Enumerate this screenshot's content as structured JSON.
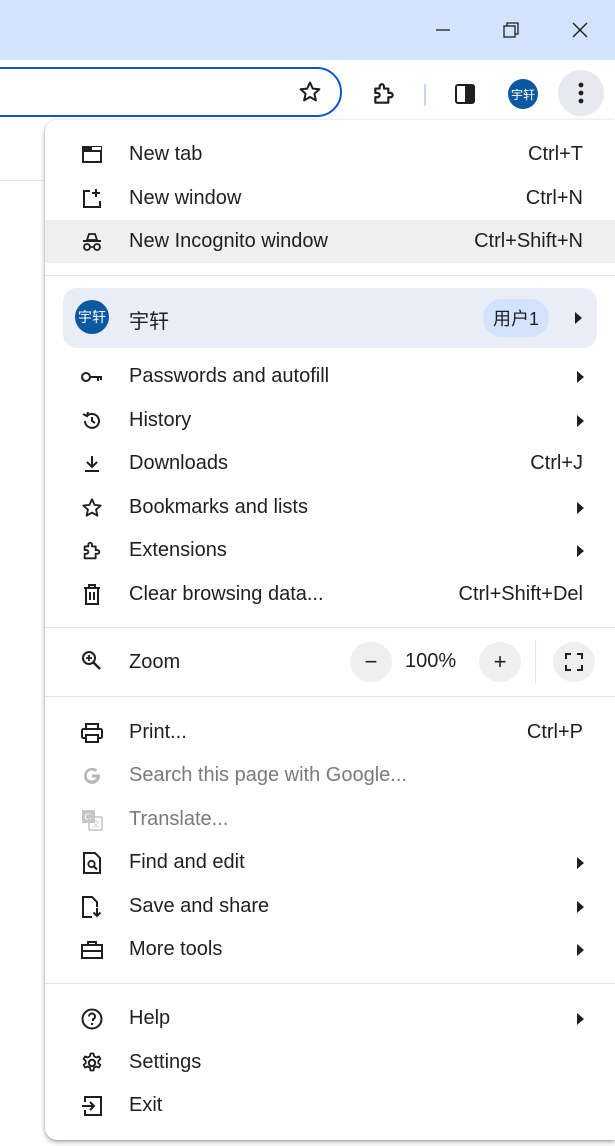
{
  "window": {
    "controls": [
      "minimize-icon",
      "restore-icon",
      "close-icon"
    ],
    "colors": {
      "titlebar": "#d3e3fd",
      "accent": "#0b57d0",
      "avatar": "#0b57a0"
    }
  },
  "toolbar": {
    "avatar_text": "宇轩"
  },
  "menu": {
    "group1": [
      {
        "icon": "new-tab-icon",
        "label": "New tab",
        "shortcut": "Ctrl+T"
      },
      {
        "icon": "new-window-icon",
        "label": "New window",
        "shortcut": "Ctrl+N"
      },
      {
        "icon": "incognito-icon",
        "label": "New Incognito window",
        "shortcut": "Ctrl+Shift+N"
      }
    ],
    "profile": {
      "avatar_text": "宇轩",
      "name": "宇轩",
      "badge": "用户1"
    },
    "group2": [
      {
        "icon": "key-icon",
        "label": "Passwords and autofill"
      },
      {
        "icon": "history-icon",
        "label": "History"
      },
      {
        "icon": "download-icon",
        "label": "Downloads",
        "shortcut": "Ctrl+J"
      },
      {
        "icon": "star-icon",
        "label": "Bookmarks and lists"
      },
      {
        "icon": "extensions-icon",
        "label": "Extensions"
      },
      {
        "icon": "trash-icon",
        "label": "Clear browsing data...",
        "shortcut": "Ctrl+Shift+Del"
      }
    ],
    "zoom": {
      "label": "Zoom",
      "value": "100%",
      "minus": "−",
      "plus": "+"
    },
    "group3": [
      {
        "icon": "print-icon",
        "label": "Print...",
        "shortcut": "Ctrl+P"
      },
      {
        "icon": "google-icon",
        "label": "Search this page with Google..."
      },
      {
        "icon": "translate-icon",
        "label": "Translate..."
      },
      {
        "icon": "find-icon",
        "label": "Find and edit"
      },
      {
        "icon": "save-share-icon",
        "label": "Save and share"
      },
      {
        "icon": "toolbox-icon",
        "label": "More tools"
      }
    ],
    "group4": [
      {
        "icon": "help-icon",
        "label": "Help"
      },
      {
        "icon": "settings-icon",
        "label": "Settings"
      },
      {
        "icon": "exit-icon",
        "label": "Exit"
      }
    ]
  }
}
